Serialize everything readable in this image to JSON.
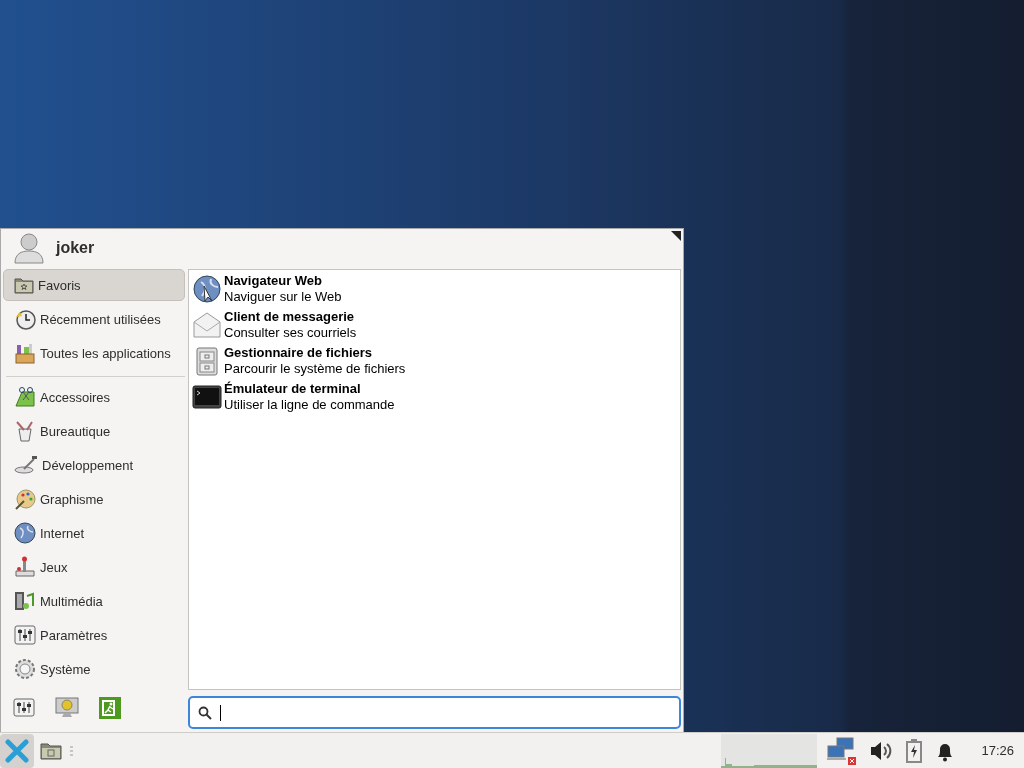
{
  "menu": {
    "user": "joker",
    "places": [
      {
        "label": "Favoris",
        "selected": true
      },
      {
        "label": "Récemment utilisées",
        "selected": false
      },
      {
        "label": "Toutes les applications",
        "selected": false
      }
    ],
    "categories": [
      {
        "label": "Accessoires",
        "selected": false
      },
      {
        "label": "Bureautique",
        "selected": false
      },
      {
        "label": "Développement",
        "selected": false
      },
      {
        "label": "Graphisme",
        "selected": false
      },
      {
        "label": "Internet",
        "selected": false
      },
      {
        "label": "Jeux",
        "selected": false
      },
      {
        "label": "Multimédia",
        "selected": false
      },
      {
        "label": "Paramètres",
        "selected": false
      },
      {
        "label": "Système",
        "selected": false
      }
    ],
    "apps": [
      {
        "name": "Navigateur Web",
        "description": "Naviguer sur le Web"
      },
      {
        "name": "Client de messagerie",
        "description": "Consulter ses courriels"
      },
      {
        "name": "Gestionnaire de fichiers",
        "description": "Parcourir le système de fichiers"
      },
      {
        "name": "Émulateur de terminal",
        "description": "Utiliser la ligne de commande"
      }
    ],
    "search": {
      "focused": true
    }
  },
  "taskbar": {
    "clock": "17:26"
  }
}
